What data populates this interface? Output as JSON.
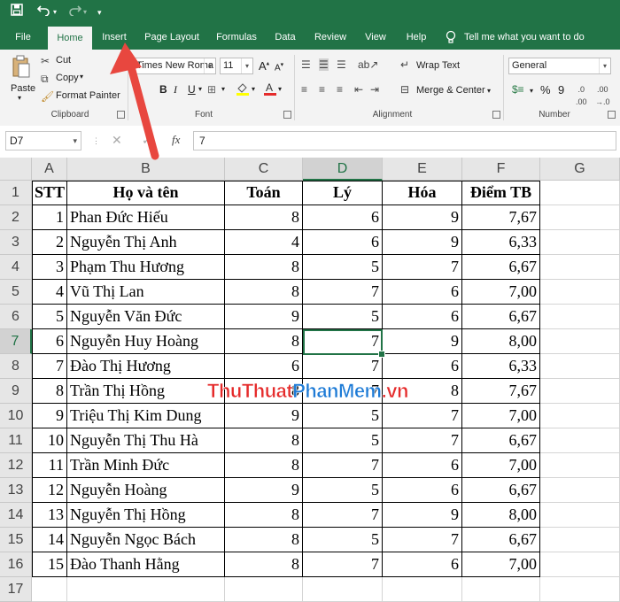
{
  "quick_access": {
    "save_icon": "save-icon",
    "undo_icon": "undo-icon",
    "redo_icon": "redo-icon",
    "customize_icon": "customize-qat-icon"
  },
  "tabs": [
    "File",
    "Home",
    "Insert",
    "Page Layout",
    "Formulas",
    "Data",
    "Review",
    "View",
    "Help"
  ],
  "tell_me": "Tell me what you want to do",
  "ribbon": {
    "clipboard": {
      "paste": "Paste",
      "cut": "Cut",
      "copy": "Copy",
      "format_painter": "Format Painter",
      "label": "Clipboard"
    },
    "font": {
      "name": "Times New Roma",
      "size": "11",
      "bold": "B",
      "italic": "I",
      "underline": "U",
      "label": "Font"
    },
    "alignment": {
      "wrap_text": "Wrap Text",
      "merge_center": "Merge & Center",
      "label": "Alignment"
    },
    "number": {
      "format": "General",
      "percent": "%",
      "comma": "9",
      "label": "Number"
    }
  },
  "formula_bar": {
    "name_box": "D7",
    "cancel": "✕",
    "enter": "✓",
    "fx": "fx",
    "content": "7"
  },
  "sheet": {
    "columns": [
      "A",
      "B",
      "C",
      "D",
      "E",
      "F",
      "G"
    ],
    "rows": [
      "1",
      "2",
      "3",
      "4",
      "5",
      "6",
      "7",
      "8",
      "9",
      "10",
      "11",
      "12",
      "13",
      "14",
      "15",
      "16",
      "17"
    ],
    "headers": [
      "STT",
      "Họ và tên",
      "Toán",
      "Lý",
      "Hóa",
      "Điểm TB"
    ],
    "data": [
      [
        "1",
        "Phan Đức Hiếu",
        "8",
        "6",
        "9",
        "7,67"
      ],
      [
        "2",
        "Nguyễn Thị Anh",
        "4",
        "6",
        "9",
        "6,33"
      ],
      [
        "3",
        "Phạm Thu Hương",
        "8",
        "5",
        "7",
        "6,67"
      ],
      [
        "4",
        "Vũ Thị Lan",
        "8",
        "7",
        "6",
        "7,00"
      ],
      [
        "5",
        "Nguyễn Văn Đức",
        "9",
        "5",
        "6",
        "6,67"
      ],
      [
        "6",
        "Nguyễn Huy Hoàng",
        "8",
        "7",
        "9",
        "8,00"
      ],
      [
        "7",
        "Đào Thị Hương",
        "6",
        "7",
        "6",
        "6,33"
      ],
      [
        "8",
        "Trần Thị Hồng",
        "8",
        "7",
        "8",
        "7,67"
      ],
      [
        "9",
        "Triệu Thị Kim Dung",
        "9",
        "5",
        "7",
        "7,00"
      ],
      [
        "10",
        "Nguyễn Thị Thu Hà",
        "8",
        "5",
        "7",
        "6,67"
      ],
      [
        "11",
        "Trần Minh Đức",
        "8",
        "7",
        "6",
        "7,00"
      ],
      [
        "12",
        "Nguyễn Hoàng",
        "9",
        "5",
        "6",
        "6,67"
      ],
      [
        "13",
        "Nguyễn Thị Hồng",
        "8",
        "7",
        "9",
        "8,00"
      ],
      [
        "14",
        "Nguyễn Ngọc Bách",
        "8",
        "5",
        "7",
        "6,67"
      ],
      [
        "15",
        "Đào Thanh Hằng",
        "8",
        "7",
        "6",
        "7,00"
      ]
    ],
    "selected_column": "D",
    "selected_row": "7"
  },
  "watermark": {
    "part1": "ThuThuat",
    "part2": "PhanMem",
    "part3": ".vn"
  },
  "colors": {
    "excel_green": "#217346",
    "arrow_red": "#e8473f",
    "watermark_red": "#e52b2b",
    "watermark_blue": "#1e7bd6"
  }
}
